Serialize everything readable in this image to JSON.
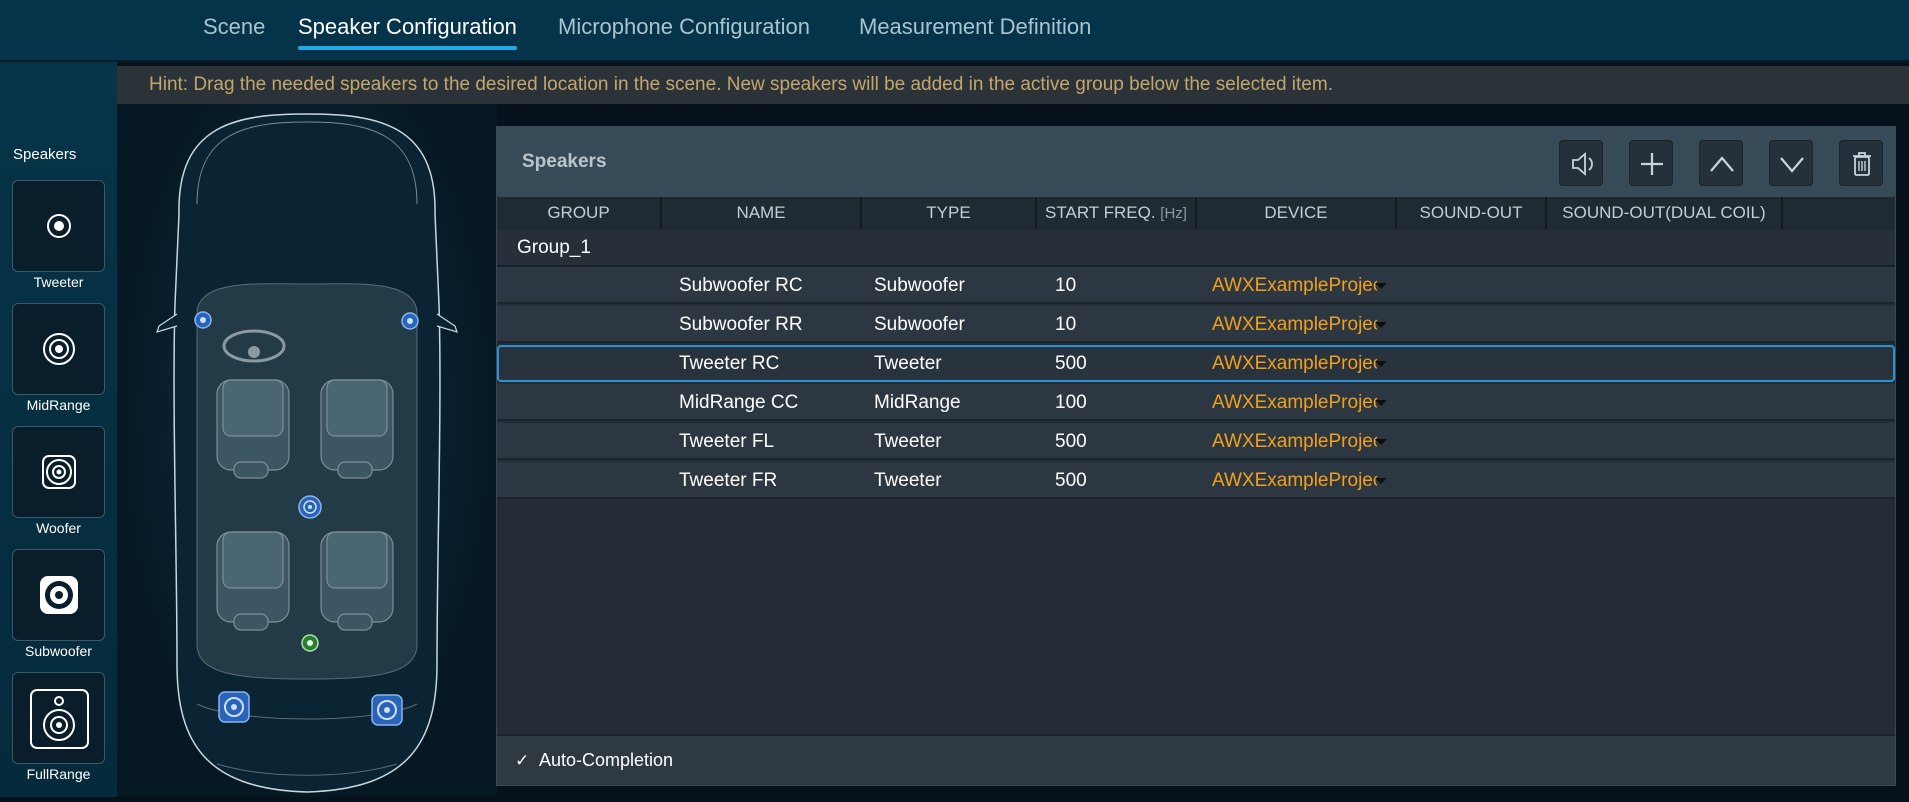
{
  "tabs": [
    {
      "label": "Scene"
    },
    {
      "label": "Speaker Configuration"
    },
    {
      "label": "Microphone Configuration"
    },
    {
      "label": "Measurement Definition"
    }
  ],
  "speaker_panel": {
    "title": "Speakers",
    "items": [
      {
        "label": "Tweeter",
        "icon": "tweeter-icon"
      },
      {
        "label": "MidRange",
        "icon": "midrange-icon"
      },
      {
        "label": "Woofer",
        "icon": "woofer-icon"
      },
      {
        "label": "Subwoofer",
        "icon": "subwoofer-icon"
      },
      {
        "label": "FullRange",
        "icon": "fullrange-icon"
      }
    ]
  },
  "hint": "Hint: Drag the needed speakers to the desired location in the scene. New speakers will be added in the active group below the selected item.",
  "table": {
    "title": "Speakers",
    "toolbar": [
      "speaker-test-icon",
      "add-icon",
      "move-up-icon",
      "move-down-icon",
      "delete-icon"
    ],
    "columns": [
      {
        "label": "GROUP"
      },
      {
        "label": "NAME"
      },
      {
        "label": "TYPE"
      },
      {
        "label": "START FREQ.",
        "unit": "[Hz]"
      },
      {
        "label": "DEVICE"
      },
      {
        "label": "SOUND-OUT"
      },
      {
        "label": "SOUND-OUT(DUAL COIL)"
      }
    ],
    "group": "Group_1",
    "rows": [
      {
        "name": "Subwoofer RC",
        "type": "Subwoofer",
        "freq": "10",
        "device": "AWXExampleProject"
      },
      {
        "name": "Subwoofer RR",
        "type": "Subwoofer",
        "freq": "10",
        "device": "AWXExampleProject"
      },
      {
        "name": "Tweeter RC",
        "type": "Tweeter",
        "freq": "500",
        "device": "AWXExampleProject"
      },
      {
        "name": "MidRange CC",
        "type": "MidRange",
        "freq": "100",
        "device": "AWXExampleProject"
      },
      {
        "name": "Tweeter FL",
        "type": "Tweeter",
        "freq": "500",
        "device": "AWXExampleProject"
      },
      {
        "name": "Tweeter FR",
        "type": "Tweeter",
        "freq": "500",
        "device": "AWXExampleProject"
      }
    ],
    "selected_row": 2
  },
  "auto_completion": {
    "label": "Auto-Completion",
    "checked": true
  },
  "colors": {
    "accent": "#21a8e8",
    "device_text": "#f0a01c",
    "hint_text": "#c3a66c"
  }
}
